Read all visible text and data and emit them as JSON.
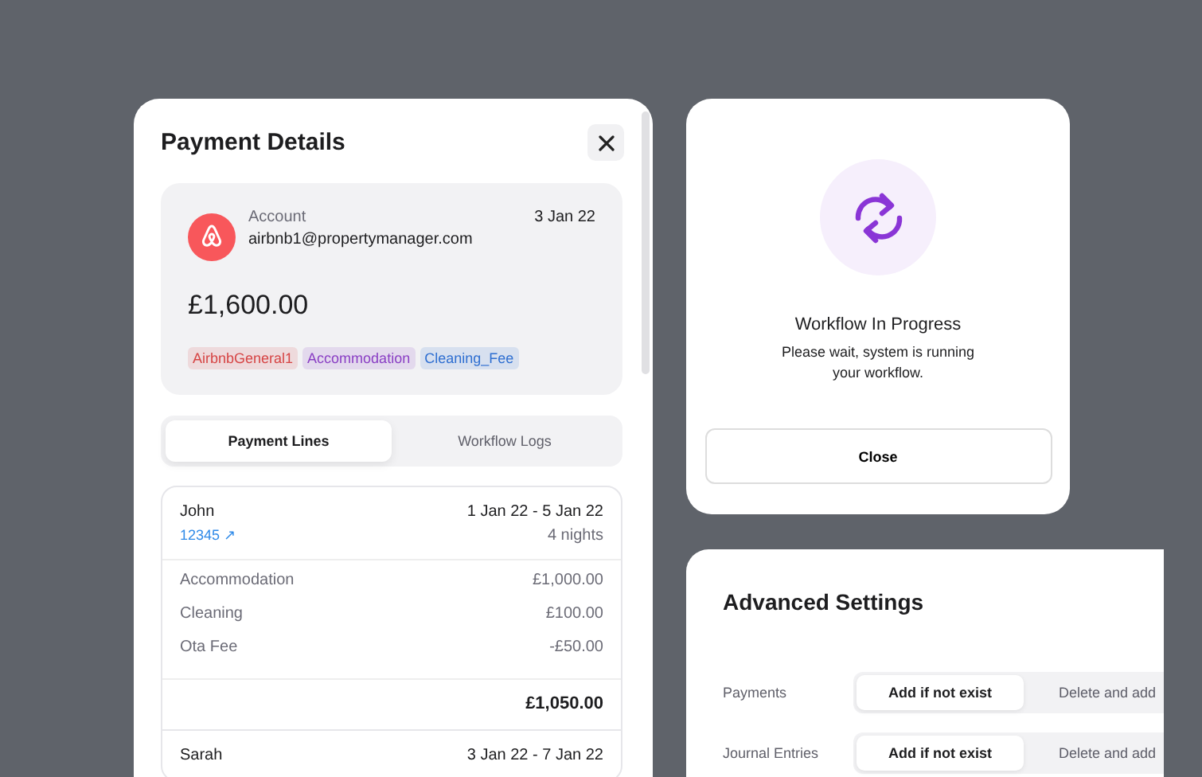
{
  "payment_details": {
    "title": "Payment Details",
    "account": {
      "label": "Account",
      "email": "airbnb1@propertymanager.com",
      "date": "3 Jan 22",
      "amount": "£1,600.00",
      "tags": [
        {
          "label": "AirbnbGeneral1",
          "color": "#d64545"
        },
        {
          "label": "Accommodation",
          "color": "#8a3fc4"
        },
        {
          "label": "Cleaning_Fee",
          "color": "#2f6fd1"
        }
      ]
    },
    "tabs": [
      {
        "label": "Payment Lines",
        "selected": true
      },
      {
        "label": "Workflow Logs",
        "selected": false
      }
    ],
    "bookings": [
      {
        "guest": "John",
        "dates": "1 Jan 22 - 5 Jan 22",
        "reference": "12345",
        "reference_icon": "↗",
        "nights": "4 nights",
        "lines": [
          {
            "label": "Accommodation",
            "amount": "£1,000.00"
          },
          {
            "label": "Cleaning",
            "amount": "£100.00"
          },
          {
            "label": "Ota Fee",
            "amount": "-£50.00"
          }
        ],
        "total": "£1,050.00"
      },
      {
        "guest": "Sarah",
        "dates": "3 Jan 22 - 7 Jan 22"
      }
    ]
  },
  "workflow_dialog": {
    "title": "Workflow In Progress",
    "message": "Please wait, system is running your workflow.",
    "button": "Close"
  },
  "advanced_settings": {
    "title": "Advanced Settings",
    "rows": [
      {
        "label": "Payments",
        "options": [
          {
            "label": "Add if not exist",
            "selected": true
          },
          {
            "label": "Delete and add",
            "selected": false
          }
        ]
      },
      {
        "label": "Journal Entries",
        "options": [
          {
            "label": "Add if not exist",
            "selected": true
          },
          {
            "label": "Delete and add",
            "selected": false
          }
        ]
      }
    ]
  }
}
